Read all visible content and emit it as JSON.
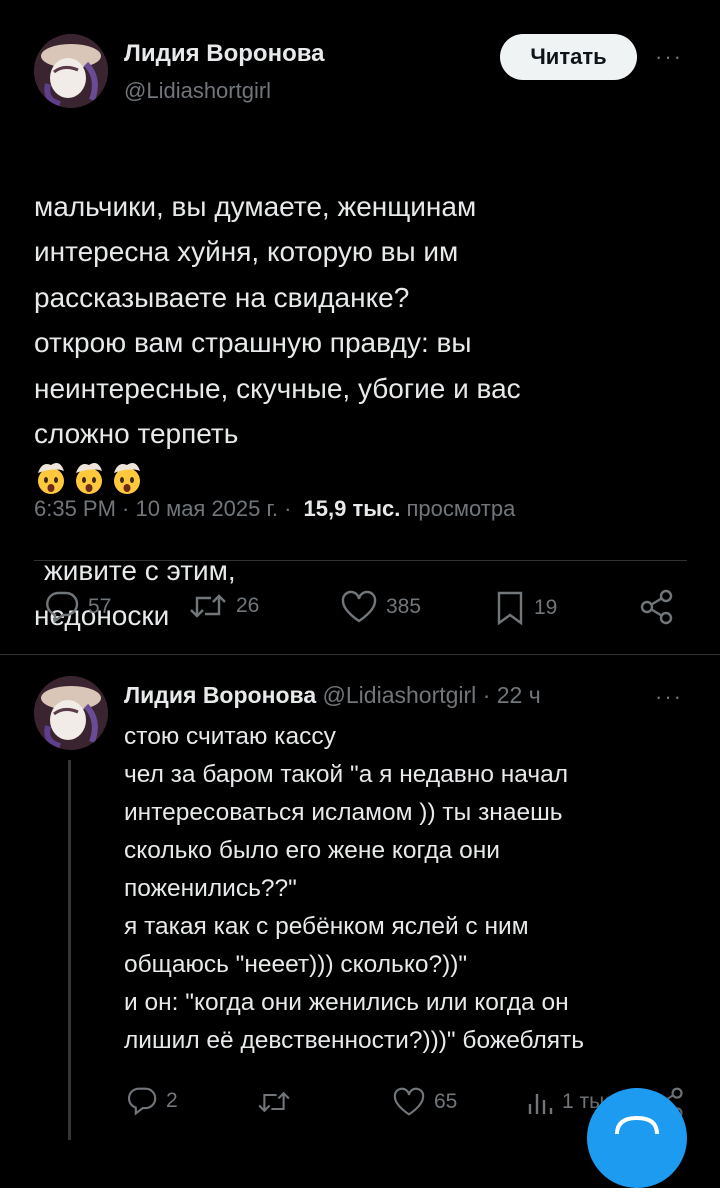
{
  "main_tweet": {
    "author_name": "Лидия Воронова",
    "handle": "@Lidiashortgirl",
    "follow_label": "Читать",
    "more_label": "···",
    "text_before_emoji": "мальчики, вы думаете, женщинам\nинтересна хуйня, которую вы им\nрассказываете на свиданке?\nоткрою вам страшную правду: вы\nнеинтересные, скучные, убогие и вас\nсложно терпеть",
    "emoji_name": "exploding-head-emoji",
    "emoji_count": 3,
    "text_after_emoji": "живите с этим,\nнедоноски",
    "time": "6:35 PM · 10 мая 2025 г. ·",
    "views_count": "15,9 тыс.",
    "views_label": "просмотра",
    "actions": {
      "replies": "57",
      "reposts": "26",
      "likes": "385",
      "bookmarks": "19"
    }
  },
  "reply_tweet": {
    "author_name": "Лидия Воронова",
    "handle": "@Lidiashortgirl",
    "time": "· 22 ч",
    "more_label": "···",
    "text": "стою считаю кассу\nчел за баром такой \"а я недавно начал\nинтересоваться исламом )) ты знаешь\nсколько было его жене когда они\nпоженились??\"\nя такая как с ребёнком яслей с ним\nобщаюсь \"нееет))) сколько?))\"\nи он: \"когда они женились или когда он\nлишил её девственности?)))\" божеблять",
    "actions": {
      "replies": "2",
      "reposts": "",
      "likes": "65",
      "views": "1 тыс."
    }
  },
  "colors": {
    "background": "#000000",
    "text": "#e7e9ea",
    "muted": "#71767b",
    "divider": "#2f3336",
    "accent": "#1d9bf0",
    "follow_bg": "#eff3f4"
  },
  "icons": {
    "reply": "reply-icon",
    "repost": "repost-icon",
    "like": "heart-icon",
    "bookmark": "bookmark-icon",
    "share": "share-icon",
    "views": "views-icon",
    "compose": "compose-fab"
  }
}
